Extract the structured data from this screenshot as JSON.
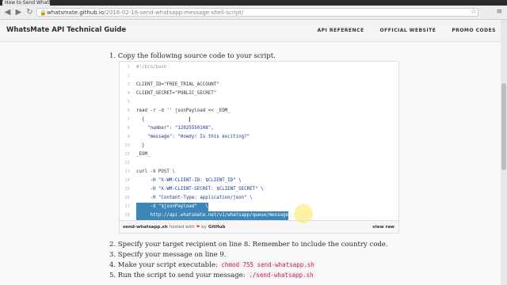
{
  "browser": {
    "tab_title": "How to Send WhatsA",
    "url_domain": "whatsmate.github.io",
    "url_path": "/2016-02-16-send-whatsapp-message-shell-script/"
  },
  "site": {
    "title": "WhatsMate API Technical Guide",
    "nav": [
      "API REFERENCE",
      "OFFICIAL WEBSITE",
      "PROMO CODES"
    ]
  },
  "steps": {
    "s1": "1. Copy the following source code to your script.",
    "s2": "2. Specify your target recipient on line 8. Remember to include the country code.",
    "s3": "3. Specify your message on line 9.",
    "s4_text": "4. Make your script executable: ",
    "s4_cmd": "chmod 755 send-whatsapp.sh",
    "s5_text": "5. Run the script to send your message: ",
    "s5_cmd": "./send-whatsapp.sh"
  },
  "gist": {
    "filename": "send-whatsapp.sh",
    "hosted_text": "hosted with",
    "heart": "❤",
    "by_text": "by",
    "host": "GitHub",
    "view_raw": "view raw",
    "lines": [
      {
        "num": "1",
        "code": "#!/bin/bash"
      },
      {
        "num": "2",
        "code": ""
      },
      {
        "num": "3",
        "code": "CLIENT_ID=\"FREE_TRIAL_ACCOUNT\""
      },
      {
        "num": "4",
        "code": "CLIENT_SECRET=\"PUBLIC_SECRET\""
      },
      {
        "num": "5",
        "code": ""
      },
      {
        "num": "6",
        "code": "read -r -d '' jsonPayload << _EOM_"
      },
      {
        "num": "7",
        "code": "  {"
      },
      {
        "num": "8",
        "code": "    \"number\": \"12025550108\","
      },
      {
        "num": "9",
        "code": "    \"message\": \"Howdy! Is this exciting?\""
      },
      {
        "num": "10",
        "code": "  }"
      },
      {
        "num": "11",
        "code": "_EOM_"
      },
      {
        "num": "12",
        "code": ""
      },
      {
        "num": "13",
        "code": "curl -X POST \\"
      },
      {
        "num": "14",
        "code": "     -H \"X-WM-CLIENT-ID: $CLIENT_ID\" \\"
      },
      {
        "num": "15",
        "code": "     -H \"X-WM-CLIENT-SECRET: $CLIENT_SECRET\" \\"
      },
      {
        "num": "16",
        "code": "     -H \"Content-Type: application/json\" \\"
      },
      {
        "num": "17",
        "code": "     -d \"$jsonPayload\"   \\"
      },
      {
        "num": "18",
        "code": "     http://api.whatsmate.net/v1/whatsapp/queue/message"
      }
    ]
  }
}
